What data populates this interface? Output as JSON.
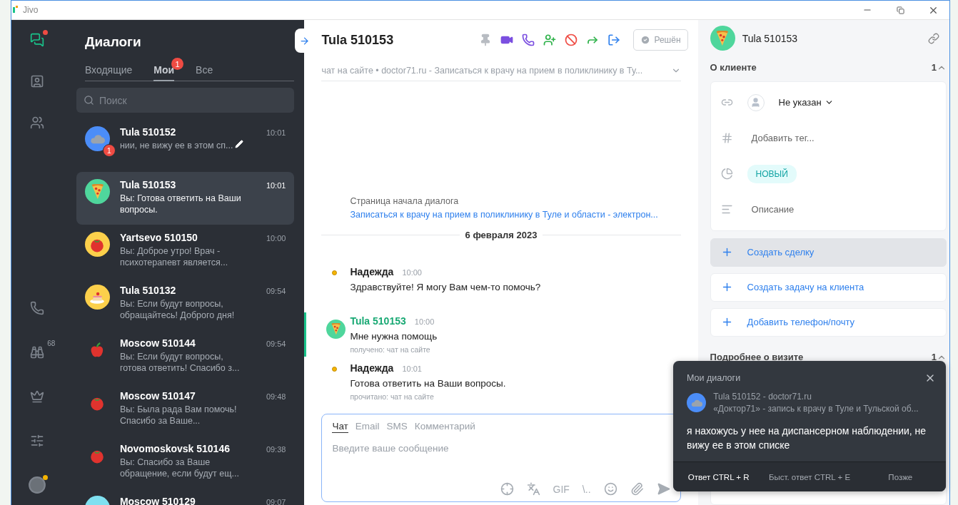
{
  "window": {
    "title": "Jivo"
  },
  "rail": {
    "top": [
      {
        "kind": "chats",
        "dot": true
      },
      {
        "kind": "contacts",
        "dot": false
      },
      {
        "kind": "team",
        "dot": false
      }
    ],
    "bottom": [
      {
        "kind": "phone",
        "dot": false
      },
      {
        "kind": "binoculars",
        "dot": false,
        "count": "68"
      },
      {
        "kind": "crown",
        "dot": false
      },
      {
        "kind": "settings",
        "dot": false
      },
      {
        "kind": "profile",
        "dot": true
      }
    ]
  },
  "dialogs": {
    "title": "Диалоги",
    "tabs": [
      {
        "label": "Входящие",
        "selected": false
      },
      {
        "label": "Мои",
        "selected": true,
        "badge": "1"
      },
      {
        "label": "Все",
        "selected": false
      }
    ],
    "search": {
      "placeholder": "Поиск"
    },
    "items": [
      {
        "name": "Tula 510152",
        "time": "10:01",
        "preview": "нии, не вижу ее в этом сп...",
        "avatar": {
          "kind": "cloud",
          "color": "#4b8df8"
        },
        "unread": "1",
        "editing": true,
        "selected": false
      },
      {
        "name": "Tula 510153",
        "time": "10:01",
        "preview": "Вы: Готова ответить на Ваши вопросы.",
        "avatar": {
          "kind": "pizza",
          "color": "#4fd69c"
        },
        "editing": false,
        "selected": true
      },
      {
        "name": "Yartsevo 510150",
        "time": "10:00",
        "preview": "Вы: Доброе утро! Врач - психотерапевт является...",
        "avatar": {
          "kind": "tomato",
          "color": "#fcd04b"
        },
        "editing": false,
        "selected": false
      },
      {
        "name": "Tula 510132",
        "time": "09:54",
        "preview": "Вы: Если будут вопросы, обращайтесь! Доброго дня!",
        "avatar": {
          "kind": "cake",
          "color": "#fcd04b"
        },
        "editing": false,
        "selected": false
      },
      {
        "name": "Moscow 510144",
        "time": "09:54",
        "preview": "Вы: Если будут вопросы, готова ответить! Спасибо з...",
        "avatar": {
          "kind": "apple"
        },
        "editing": false,
        "selected": false
      },
      {
        "name": "Moscow 510147",
        "time": "09:48",
        "preview": "Вы: Была рада Вам помочь! Спасибо за Ваше...",
        "avatar": {
          "kind": "tomato"
        },
        "editing": false,
        "selected": false
      },
      {
        "name": "Novomoskovsk 510146",
        "time": "09:38",
        "preview": "Вы: Спасибо за Ваше обращение, если будут ещ...",
        "avatar": {
          "kind": "tomato"
        },
        "editing": false,
        "selected": false
      },
      {
        "name": "Moscow 510129",
        "time": "09:07",
        "avatar": {
          "kind": "blank",
          "color": "#7fe0f0"
        },
        "editing": false,
        "selected": false
      }
    ]
  },
  "chat": {
    "title": "Tula 510153",
    "actions": [
      {
        "kind": "pin"
      },
      {
        "kind": "video"
      },
      {
        "kind": "call"
      },
      {
        "kind": "invite"
      },
      {
        "kind": "block"
      },
      {
        "kind": "forward"
      },
      {
        "kind": "leave"
      }
    ],
    "resolve": "Решён",
    "subtitle": "чат на сайте • doctor71.ru - Записаться к врачу на прием в поликлинику в Ту...",
    "origin": {
      "label": "Страница начала диалога",
      "link": "Записаться к врачу на прием в поликлинику в Туле и области - электрон..."
    },
    "date": "6 февраля 2023",
    "messages": [
      {
        "kind": "agent",
        "author": "Надежда",
        "time": "10:00",
        "text": "Здравствуйте! Я могу Вам чем-то помочь?"
      },
      {
        "kind": "client",
        "author": "Tula 510153",
        "time": "10:00",
        "text": "Мне нужна помощь",
        "status": "получено: чат на сайте"
      },
      {
        "kind": "agent",
        "author": "Надежда",
        "time": "10:01",
        "text": "Готова ответить на Ваши вопросы.",
        "status": "прочитано: чат на сайте"
      }
    ],
    "composer": {
      "tabs": [
        {
          "label": "Чат",
          "selected": true
        },
        {
          "label": "Email",
          "selected": false
        },
        {
          "label": "SMS",
          "selected": false
        },
        {
          "label": "Комментарий",
          "selected": false
        }
      ],
      "placeholder": "Введите ваше сообщение",
      "tools": [
        {
          "kind": "target"
        },
        {
          "kind": "translate"
        },
        {
          "kind": "text",
          "label": "GIF"
        },
        {
          "kind": "text",
          "label": "\\.."
        },
        {
          "kind": "emoji"
        },
        {
          "kind": "attach"
        },
        {
          "kind": "send"
        }
      ]
    }
  },
  "client": {
    "name": "Tula 510153",
    "about": {
      "title": "О клиенте",
      "count": "1",
      "expanded": true,
      "fields": [
        {
          "kind": "contact",
          "value": "Не указан"
        },
        {
          "kind": "tags",
          "placeholder": "Добавить тег..."
        },
        {
          "kind": "status",
          "value": "НОВЫЙ"
        },
        {
          "kind": "description",
          "placeholder": "Описание"
        }
      ]
    },
    "actions": [
      {
        "label": "Создать сделку",
        "highlighted": true
      },
      {
        "label": "Создать задачу на клиента",
        "highlighted": false
      },
      {
        "label": "Добавить телефон/почту",
        "highlighted": false
      }
    ],
    "visit": {
      "title": "Подробнее о визите",
      "count": "1",
      "expanded": true
    }
  },
  "notification": {
    "title": "Мои диалоги",
    "sender": "Tula 510152 - doctor71.ru",
    "site": "«Доктор71» - запись к врачу в Туле и Тульской об...",
    "avatar": {
      "kind": "cloud",
      "color": "#4b8df8"
    },
    "text": "я нахожусь у нее на диспансерном наблюдении, не вижу ее в этом списке",
    "actions": [
      {
        "label": "Ответ",
        "shortcut": "CTRL + R",
        "primary": true
      },
      {
        "label": "Быст. ответ",
        "shortcut": "CTRL + E",
        "primary": false
      },
      {
        "label": "Позже",
        "primary": false
      }
    ]
  }
}
